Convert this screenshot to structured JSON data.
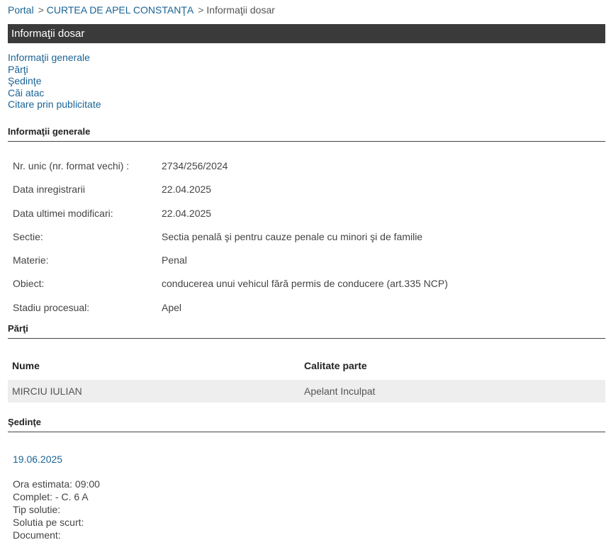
{
  "breadcrumb": {
    "portal": "Portal",
    "court": "CURTEA DE APEL CONSTANŢA",
    "current": "Informaţii dosar",
    "separator": ">"
  },
  "title": "Informaţii dosar",
  "nav": [
    "Informaţii generale",
    "Părţi",
    "Şedinţe",
    "Căi atac",
    "Citare prin publicitate"
  ],
  "general": {
    "heading": "Informaţii generale",
    "rows": [
      {
        "label": "Nr. unic (nr. format vechi) :",
        "value": "2734/256/2024"
      },
      {
        "label": "Data inregistrarii",
        "value": "22.04.2025"
      },
      {
        "label": "Data ultimei modificari:",
        "value": "22.04.2025"
      },
      {
        "label": "Sectie:",
        "value": "Sectia penală şi pentru cauze penale cu minori şi de familie"
      },
      {
        "label": "Materie:",
        "value": "Penal"
      },
      {
        "label": "Obiect:",
        "value": "conducerea unui vehicul fără permis de conducere (art.335 NCP)"
      },
      {
        "label": "Stadiu procesual:",
        "value": "Apel"
      }
    ]
  },
  "parti": {
    "heading": "Părţi",
    "col_name": "Nume",
    "col_role": "Calitate parte",
    "rows": [
      {
        "name": "MIRCIU IULIAN",
        "role": "Apelant Inculpat"
      }
    ]
  },
  "sedinte": {
    "heading": "Şedinţe",
    "date": "19.06.2025",
    "details": [
      "Ora estimata: 09:00",
      "Complet: - C. 6 A",
      "Tip solutie:",
      "Solutia pe scurt:",
      "Document:"
    ]
  }
}
